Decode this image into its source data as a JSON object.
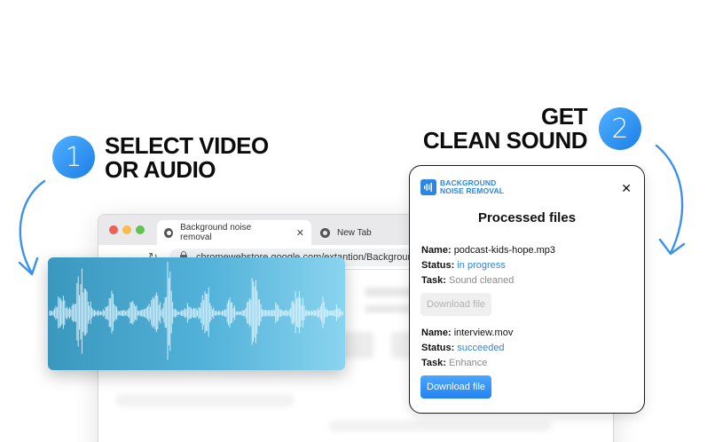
{
  "steps": [
    {
      "number": "1",
      "line1": "SELECT VIDEO",
      "line2": "OR AUDIO"
    },
    {
      "number": "2",
      "line1": "GET",
      "line2": "CLEAN SOUND"
    }
  ],
  "browser": {
    "tabs": [
      {
        "label": "Background noise removal",
        "close": "✕"
      },
      {
        "label": "New Tab"
      }
    ],
    "nav": {
      "back": "←",
      "forward": "→",
      "reload": "↻"
    },
    "url": "chromewebstore.google.com/extantion/Background"
  },
  "panel": {
    "logo_line1": "BACKGROUND",
    "logo_line2": "NOISE REMOVAL",
    "close": "✕",
    "title": "Processed files",
    "files": [
      {
        "name_label": "Name:",
        "name": "podcast-kids-hope.mp3",
        "status_label": "Status:",
        "status": "in progress",
        "task_label": "Task:",
        "task": "Sound cleaned",
        "button": "Download file",
        "button_enabled": false
      },
      {
        "name_label": "Name:",
        "name": "interview.mov",
        "status_label": "Status:",
        "status": "succeeded",
        "task_label": "Task:",
        "task": "Enhance",
        "button": "Download file",
        "button_enabled": true
      }
    ]
  },
  "colors": {
    "accent": "#2b86e4",
    "badge": "#2f8ff0",
    "wave_bg": "#54b3da",
    "muted": "#8c8c8c"
  },
  "icons": {
    "badge1": "step-number-badge",
    "badge2": "step-number-badge",
    "arrows": "curved-arrow-icon",
    "logo": "waveform-logo-icon",
    "close": "close-icon",
    "tab": "chrome-icon"
  }
}
